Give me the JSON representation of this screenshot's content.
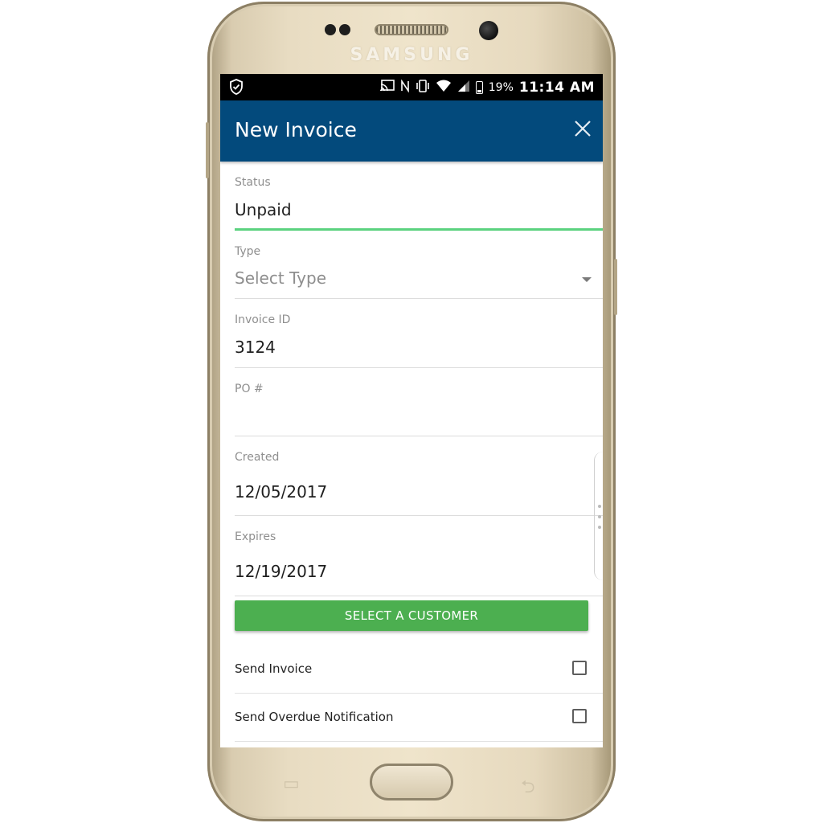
{
  "device": {
    "brand": "SAMSUNG"
  },
  "statusbar": {
    "battery_percent": "19%",
    "time": "11:14 AM",
    "icons": [
      "shield-check-icon",
      "cast-icon",
      "nfc-icon",
      "vibrate-icon",
      "wifi-icon",
      "signal-icon",
      "battery-icon"
    ]
  },
  "appbar": {
    "title": "New Invoice",
    "close_icon": "close-icon",
    "background_color": "#034a7c"
  },
  "form": {
    "status": {
      "label": "Status",
      "value": "Unpaid"
    },
    "type": {
      "label": "Type",
      "placeholder": "Select Type"
    },
    "invoice_id": {
      "label": "Invoice ID",
      "value": "3124"
    },
    "po": {
      "label": "PO #",
      "value": ""
    },
    "created": {
      "label": "Created",
      "value": "12/05/2017"
    },
    "expires": {
      "label": "Expires",
      "value": "12/19/2017"
    },
    "select_customer_label": "SELECT A CUSTOMER",
    "accent_color": "#4caf50",
    "active_underline_color": "#5bd27f"
  },
  "options": [
    {
      "label": "Send Invoice",
      "checked": false
    },
    {
      "label": "Send Overdue Notification",
      "checked": false
    }
  ]
}
